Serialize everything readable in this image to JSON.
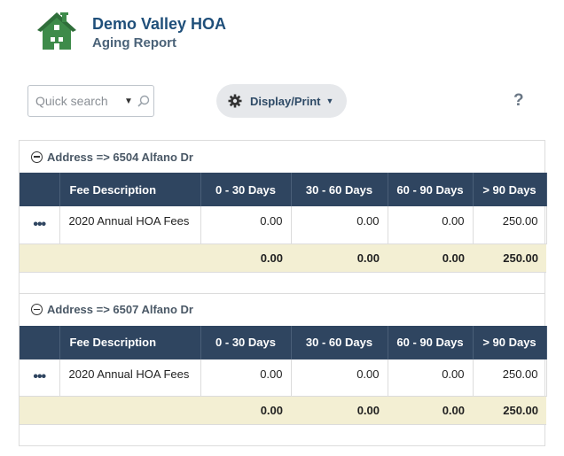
{
  "header": {
    "title": "Demo Valley HOA",
    "subtitle": "Aging Report"
  },
  "toolbar": {
    "search_placeholder": "Quick search",
    "display_label": "Display/Print",
    "help_label": "?"
  },
  "columns": [
    "Fee Description",
    "0 - 30 Days",
    "30 - 60 Days",
    "60 - 90 Days",
    "> 90 Days"
  ],
  "groups": [
    {
      "label": "Address => 6504 Alfano Dr",
      "rows": [
        {
          "menu": "•••",
          "description": "2020 Annual HOA Fees",
          "d0_30": "0.00",
          "d30_60": "0.00",
          "d60_90": "0.00",
          "d90_plus": "250.00"
        }
      ],
      "totals": {
        "d0_30": "0.00",
        "d30_60": "0.00",
        "d60_90": "0.00",
        "d90_plus": "250.00"
      }
    },
    {
      "label": "Address => 6507 Alfano Dr",
      "rows": [
        {
          "menu": "•••",
          "description": "2020 Annual HOA Fees",
          "d0_30": "0.00",
          "d30_60": "0.00",
          "d60_90": "0.00",
          "d90_plus": "250.00"
        }
      ],
      "totals": {
        "d0_30": "0.00",
        "d30_60": "0.00",
        "d60_90": "0.00",
        "d90_plus": "250.00"
      }
    }
  ],
  "colors": {
    "brand_green": "#3e8b4a",
    "header_bg": "#2f4560",
    "total_bg": "#f3efd3",
    "title_blue": "#1f4f7a"
  }
}
